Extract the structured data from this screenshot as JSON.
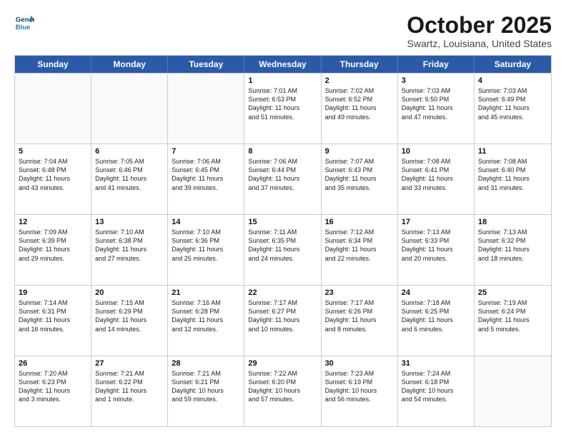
{
  "header": {
    "logo_line1": "General",
    "logo_line2": "Blue",
    "month_title": "October 2025",
    "location": "Swartz, Louisiana, United States"
  },
  "days": [
    "Sunday",
    "Monday",
    "Tuesday",
    "Wednesday",
    "Thursday",
    "Friday",
    "Saturday"
  ],
  "rows": [
    [
      {
        "day": "",
        "text": ""
      },
      {
        "day": "",
        "text": ""
      },
      {
        "day": "",
        "text": ""
      },
      {
        "day": "1",
        "text": "Sunrise: 7:01 AM\nSunset: 6:53 PM\nDaylight: 11 hours\nand 51 minutes."
      },
      {
        "day": "2",
        "text": "Sunrise: 7:02 AM\nSunset: 6:52 PM\nDaylight: 11 hours\nand 49 minutes."
      },
      {
        "day": "3",
        "text": "Sunrise: 7:03 AM\nSunset: 6:50 PM\nDaylight: 11 hours\nand 47 minutes."
      },
      {
        "day": "4",
        "text": "Sunrise: 7:03 AM\nSunset: 6:49 PM\nDaylight: 11 hours\nand 45 minutes."
      }
    ],
    [
      {
        "day": "5",
        "text": "Sunrise: 7:04 AM\nSunset: 6:48 PM\nDaylight: 11 hours\nand 43 minutes."
      },
      {
        "day": "6",
        "text": "Sunrise: 7:05 AM\nSunset: 6:46 PM\nDaylight: 11 hours\nand 41 minutes."
      },
      {
        "day": "7",
        "text": "Sunrise: 7:06 AM\nSunset: 6:45 PM\nDaylight: 11 hours\nand 39 minutes."
      },
      {
        "day": "8",
        "text": "Sunrise: 7:06 AM\nSunset: 6:44 PM\nDaylight: 11 hours\nand 37 minutes."
      },
      {
        "day": "9",
        "text": "Sunrise: 7:07 AM\nSunset: 6:43 PM\nDaylight: 11 hours\nand 35 minutes."
      },
      {
        "day": "10",
        "text": "Sunrise: 7:08 AM\nSunset: 6:41 PM\nDaylight: 11 hours\nand 33 minutes."
      },
      {
        "day": "11",
        "text": "Sunrise: 7:08 AM\nSunset: 6:40 PM\nDaylight: 11 hours\nand 31 minutes."
      }
    ],
    [
      {
        "day": "12",
        "text": "Sunrise: 7:09 AM\nSunset: 6:39 PM\nDaylight: 11 hours\nand 29 minutes."
      },
      {
        "day": "13",
        "text": "Sunrise: 7:10 AM\nSunset: 6:38 PM\nDaylight: 11 hours\nand 27 minutes."
      },
      {
        "day": "14",
        "text": "Sunrise: 7:10 AM\nSunset: 6:36 PM\nDaylight: 11 hours\nand 25 minutes."
      },
      {
        "day": "15",
        "text": "Sunrise: 7:11 AM\nSunset: 6:35 PM\nDaylight: 11 hours\nand 24 minutes."
      },
      {
        "day": "16",
        "text": "Sunrise: 7:12 AM\nSunset: 6:34 PM\nDaylight: 11 hours\nand 22 minutes."
      },
      {
        "day": "17",
        "text": "Sunrise: 7:13 AM\nSunset: 6:33 PM\nDaylight: 11 hours\nand 20 minutes."
      },
      {
        "day": "18",
        "text": "Sunrise: 7:13 AM\nSunset: 6:32 PM\nDaylight: 11 hours\nand 18 minutes."
      }
    ],
    [
      {
        "day": "19",
        "text": "Sunrise: 7:14 AM\nSunset: 6:31 PM\nDaylight: 11 hours\nand 16 minutes."
      },
      {
        "day": "20",
        "text": "Sunrise: 7:15 AM\nSunset: 6:29 PM\nDaylight: 11 hours\nand 14 minutes."
      },
      {
        "day": "21",
        "text": "Sunrise: 7:16 AM\nSunset: 6:28 PM\nDaylight: 11 hours\nand 12 minutes."
      },
      {
        "day": "22",
        "text": "Sunrise: 7:17 AM\nSunset: 6:27 PM\nDaylight: 11 hours\nand 10 minutes."
      },
      {
        "day": "23",
        "text": "Sunrise: 7:17 AM\nSunset: 6:26 PM\nDaylight: 11 hours\nand 8 minutes."
      },
      {
        "day": "24",
        "text": "Sunrise: 7:18 AM\nSunset: 6:25 PM\nDaylight: 11 hours\nand 6 minutes."
      },
      {
        "day": "25",
        "text": "Sunrise: 7:19 AM\nSunset: 6:24 PM\nDaylight: 11 hours\nand 5 minutes."
      }
    ],
    [
      {
        "day": "26",
        "text": "Sunrise: 7:20 AM\nSunset: 6:23 PM\nDaylight: 11 hours\nand 3 minutes."
      },
      {
        "day": "27",
        "text": "Sunrise: 7:21 AM\nSunset: 6:22 PM\nDaylight: 11 hours\nand 1 minute."
      },
      {
        "day": "28",
        "text": "Sunrise: 7:21 AM\nSunset: 6:21 PM\nDaylight: 10 hours\nand 59 minutes."
      },
      {
        "day": "29",
        "text": "Sunrise: 7:22 AM\nSunset: 6:20 PM\nDaylight: 10 hours\nand 57 minutes."
      },
      {
        "day": "30",
        "text": "Sunrise: 7:23 AM\nSunset: 6:19 PM\nDaylight: 10 hours\nand 56 minutes."
      },
      {
        "day": "31",
        "text": "Sunrise: 7:24 AM\nSunset: 6:18 PM\nDaylight: 10 hours\nand 54 minutes."
      },
      {
        "day": "",
        "text": ""
      }
    ]
  ]
}
